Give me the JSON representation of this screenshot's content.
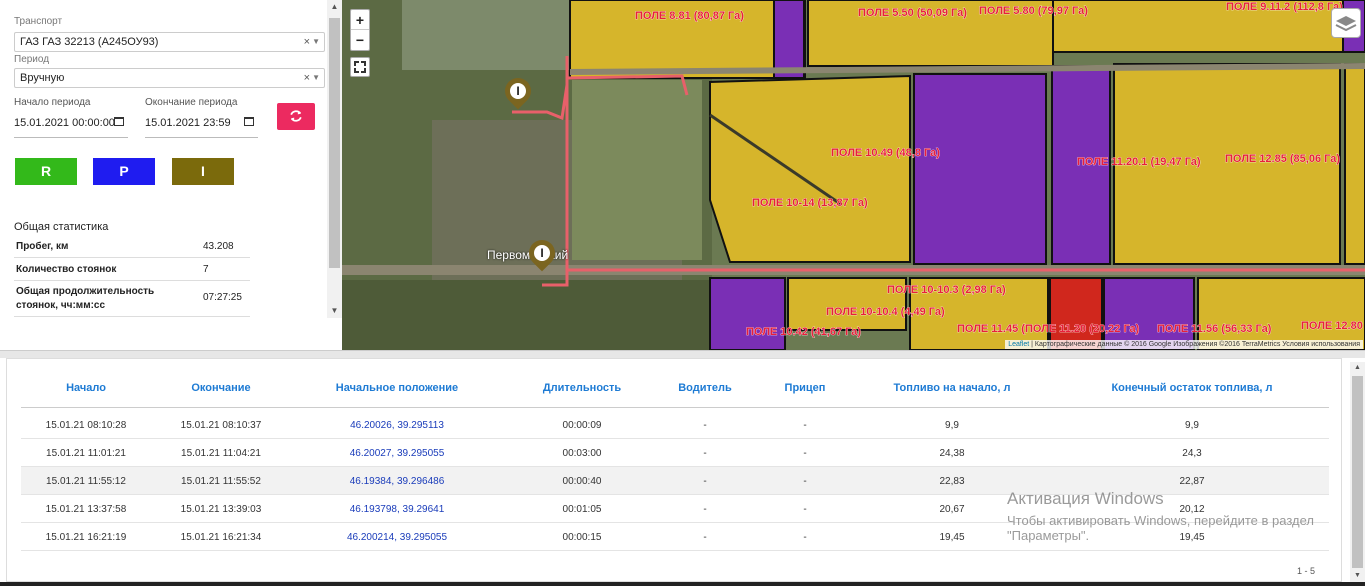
{
  "filters": {
    "transport_label": "Транспорт",
    "transport_value": "ГАЗ ГАЗ 32213 (А245ОУ93)",
    "period_label": "Период",
    "period_value": "Вручную",
    "clear_glyph": "×",
    "start_label": "Начало периода",
    "start_value": "15.01.2021 00:00:00",
    "end_label": "Окончание периода",
    "end_value": "15.01.2021 23:59",
    "refresh_icon": "refresh-icon"
  },
  "mode_buttons": [
    {
      "label": "R",
      "color": "#33b91a"
    },
    {
      "label": "P",
      "color": "#1f1cf0"
    },
    {
      "label": "I",
      "color": "#7b6a0c"
    }
  ],
  "stats": {
    "title": "Общая статистика",
    "rows": [
      {
        "key": "Пробег, км",
        "value": "43.208"
      },
      {
        "key": "Количество стоянок",
        "value": "7"
      },
      {
        "key": "Общая продолжительность стоянок, чч:мм:сс",
        "value": "07:27:25"
      }
    ]
  },
  "map": {
    "zoom_in": "+",
    "zoom_out": "−",
    "town": "Первомайский",
    "marker_glyph": "I",
    "attribution_link": "Leaflet",
    "attribution_text": "| Картографические данные © 2016 Google Изображения ©2016 TerraMetrics Условия использования",
    "field_labels": [
      "ПОЛЕ 8.81 (80,87 Га)",
      "ПОЛЕ 5.50 (50,09 Га)",
      "ПОЛЕ 5.80 (79,97 Га)",
      "ПОЛЕ 9.11.2 (112,8 Га)",
      "ПОЛЕ 10.49 (48,8 Га)",
      "ПОЛЕ 11.20.1 (19,47 Га)",
      "ПОЛЕ 12.85 (85,06 Га)",
      "ПОЛЕ 10-14 (13,87 Га)",
      "ПОЛЕ 10-10.3 (2,98 Га)",
      "ПОЛЕ 10-10.4 (4,49 Га)",
      "ПОЛЕ 10.42 (41,67 Га)",
      "ПОЛЕ 11.45 (ПОЛЕ 11.20 (20,22 Га)",
      "ПОЛЕ 11.56 (56,33 Га)",
      "ПОЛЕ 12.80"
    ],
    "colors": {
      "field_yellow": "#d6b52b",
      "field_purple": "#7a2fb5",
      "field_red": "#d0271d",
      "route": "#e8606a",
      "label": "#e8203a"
    }
  },
  "table": {
    "headers": [
      "Начало",
      "Окончание",
      "Начальное положение",
      "Длительность",
      "Водитель",
      "Прицеп",
      "Топливо на начало, л",
      "Конечный остаток топлива, л"
    ],
    "rows": [
      [
        "15.01.21 08:10:28",
        "15.01.21 08:10:37",
        "46.20026, 39.295113",
        "00:00:09",
        "-",
        "-",
        "9,9",
        "9,9"
      ],
      [
        "15.01.21 11:01:21",
        "15.01.21 11:04:21",
        "46.20027, 39.295055",
        "00:03:00",
        "-",
        "-",
        "24,38",
        "24,3"
      ],
      [
        "15.01.21 11:55:12",
        "15.01.21 11:55:52",
        "46.19384, 39.296486",
        "00:00:40",
        "-",
        "-",
        "22,83",
        "22,87"
      ],
      [
        "15.01.21 13:37:58",
        "15.01.21 13:39:03",
        "46.193798, 39.29641",
        "00:01:05",
        "-",
        "-",
        "20,67",
        "20,12"
      ],
      [
        "15.01.21 16:21:19",
        "15.01.21 16:21:34",
        "46.200214, 39.295055",
        "00:00:15",
        "-",
        "-",
        "19,45",
        "19,45"
      ]
    ],
    "pager": "1 - 5"
  },
  "watermark": {
    "title": "Активация Windows",
    "text": "Чтобы активировать Windows, перейдите в раздел \"Параметры\"."
  }
}
